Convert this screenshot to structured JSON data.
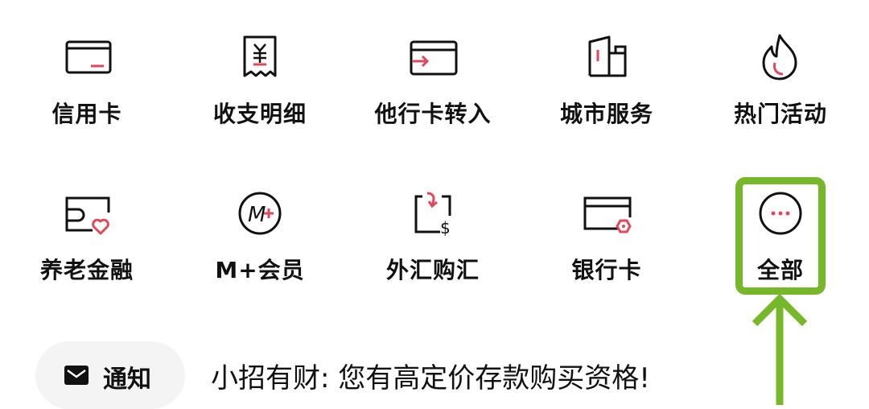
{
  "grid": {
    "row1": [
      {
        "label": "信用卡",
        "icon": "credit-card-icon"
      },
      {
        "label": "收支明细",
        "icon": "receipt-yen-icon"
      },
      {
        "label": "他行卡转入",
        "icon": "card-transfer-in-icon"
      },
      {
        "label": "城市服务",
        "icon": "city-buildings-icon"
      },
      {
        "label": "热门活动",
        "icon": "flame-icon"
      }
    ],
    "row2": [
      {
        "label": "养老金融",
        "icon": "pension-card-heart-icon"
      },
      {
        "label": "M+会员",
        "icon": "m-plus-member-icon"
      },
      {
        "label": "外汇购汇",
        "icon": "forex-dollar-icon"
      },
      {
        "label": "银行卡",
        "icon": "bank-card-icon"
      },
      {
        "label": "全部",
        "icon": "more-dots-icon"
      }
    ]
  },
  "notice": {
    "pill_label": "通知",
    "message": "小招有财: 您有高定价存款购买资格!"
  },
  "colors": {
    "accent_red": "#e2475a",
    "highlight_green": "#76b82a",
    "stroke": "#111111"
  }
}
